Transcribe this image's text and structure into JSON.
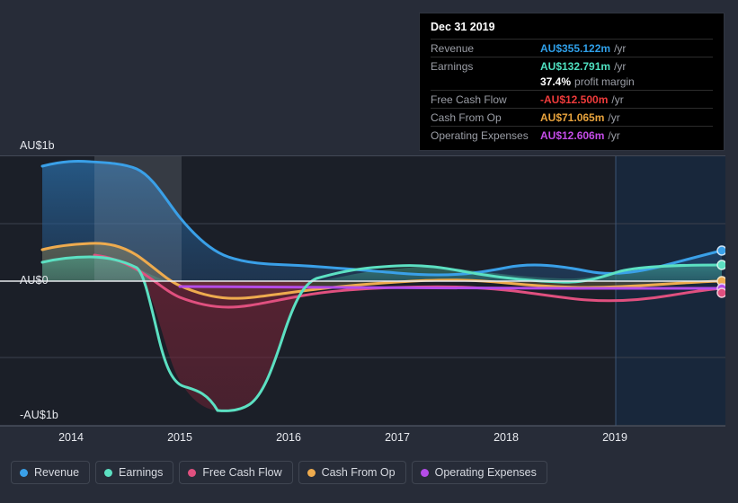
{
  "axes": {
    "y_labels": [
      "AU$1b",
      "AU$0",
      "-AU$1b"
    ],
    "x_labels": [
      "2014",
      "2015",
      "2016",
      "2017",
      "2018",
      "2019"
    ]
  },
  "tooltip": {
    "date": "Dec 31 2019",
    "rows": [
      {
        "key": "Revenue",
        "value": "AU$355.122m",
        "unit": "/yr",
        "color": "#2f9fe8"
      },
      {
        "key": "Earnings",
        "value": "AU$132.791m",
        "unit": "/yr",
        "color": "#4fe0c0"
      },
      {
        "key": "",
        "value": "37.4%",
        "unit": "profit margin",
        "color": "#ffffff"
      },
      {
        "key": "Free Cash Flow",
        "value": "-AU$12.500m",
        "unit": "/yr",
        "color": "#ef3b3b"
      },
      {
        "key": "Cash From Op",
        "value": "AU$71.065m",
        "unit": "/yr",
        "color": "#e8a33d"
      },
      {
        "key": "Operating Expenses",
        "value": "AU$12.606m",
        "unit": "/yr",
        "color": "#c44ce8"
      }
    ]
  },
  "legend": {
    "items": [
      {
        "label": "Revenue",
        "color": "#3aa0e8"
      },
      {
        "label": "Earnings",
        "color": "#5ce0c2"
      },
      {
        "label": "Free Cash Flow",
        "color": "#e0507f"
      },
      {
        "label": "Cash From Op",
        "color": "#eeab4e"
      },
      {
        "label": "Operating Expenses",
        "color": "#b44ce8"
      }
    ]
  },
  "chart_data": {
    "type": "area",
    "title": "",
    "xlabel": "",
    "ylabel": "AU$",
    "currency": "AU$",
    "xlim": [
      2013.73,
      2020.0
    ],
    "ylim": [
      -1000,
      1000
    ],
    "x_tick_values": [
      2014,
      2015,
      2016,
      2017,
      2018,
      2019
    ],
    "x_tick_labels": [
      "2014",
      "2015",
      "2016",
      "2017",
      "2018",
      "2019"
    ],
    "y_tick_values": [
      1000,
      0,
      -1000
    ],
    "y_tick_labels": [
      "AU$1b",
      "AU$0",
      "-AU$1b"
    ],
    "units": "millions AU$",
    "grid": true,
    "legend_position": "bottom",
    "highlight_line_x": 2019.0,
    "x": [
      2013.73,
      2014.0,
      2014.25,
      2014.5,
      2014.75,
      2015.0,
      2015.25,
      2015.5,
      2015.75,
      2016.0,
      2016.25,
      2016.5,
      2016.75,
      2017.0,
      2017.25,
      2017.5,
      2017.75,
      2018.0,
      2018.25,
      2018.5,
      2018.75,
      2019.0,
      2019.25,
      2019.5,
      2019.75,
      2020.0
    ],
    "series": [
      {
        "name": "Revenue",
        "color": "#3aa0e8",
        "values": [
          855,
          880,
          880,
          862,
          760,
          640,
          520,
          430,
          400,
          392,
          382,
          372,
          362,
          352,
          345,
          338,
          335,
          342,
          355,
          362,
          356,
          344,
          338,
          344,
          352,
          358
        ]
      },
      {
        "name": "Earnings",
        "color": "#5ce0c2",
        "values": [
          185,
          200,
          196,
          175,
          90,
          -660,
          -905,
          -955,
          -952,
          -870,
          -460,
          -100,
          10,
          45,
          72,
          88,
          92,
          78,
          58,
          45,
          48,
          64,
          98,
          126,
          133,
          133
        ]
      },
      {
        "name": "Free Cash Flow",
        "color": "#e0507f",
        "values": [
          null,
          null,
          225,
          212,
          160,
          60,
          -55,
          -98,
          -110,
          -104,
          -74,
          -38,
          -14,
          -6,
          -2,
          2,
          6,
          5,
          2,
          -4,
          -18,
          -38,
          -48,
          -44,
          -24,
          -12.5
        ]
      },
      {
        "name": "Cash From Op",
        "color": "#eeab4e",
        "values": [
          235,
          258,
          262,
          248,
          205,
          110,
          10,
          -40,
          -52,
          -44,
          -12,
          14,
          28,
          36,
          44,
          54,
          60,
          58,
          48,
          38,
          34,
          38,
          48,
          62,
          70,
          71
        ]
      },
      {
        "name": "Operating Expenses",
        "color": "#b44ce8",
        "values": [
          null,
          null,
          null,
          null,
          null,
          38,
          36,
          34,
          32,
          30,
          28,
          26,
          24,
          22,
          20,
          19,
          18,
          17,
          16,
          15,
          14,
          13.5,
          13.2,
          13,
          12.8,
          12.6
        ]
      }
    ],
    "end_markers": [
      {
        "name": "Revenue",
        "value": 358,
        "color": "#3aa0e8"
      },
      {
        "name": "Earnings",
        "value": 133,
        "color": "#5ce0c2"
      },
      {
        "name": "Cash From Op",
        "value": 71,
        "color": "#eeab4e"
      },
      {
        "name": "Operating Expenses",
        "value": 12.6,
        "color": "#b44ce8"
      },
      {
        "name": "Free Cash Flow",
        "value": -12.5,
        "color": "#e0507f"
      }
    ]
  }
}
